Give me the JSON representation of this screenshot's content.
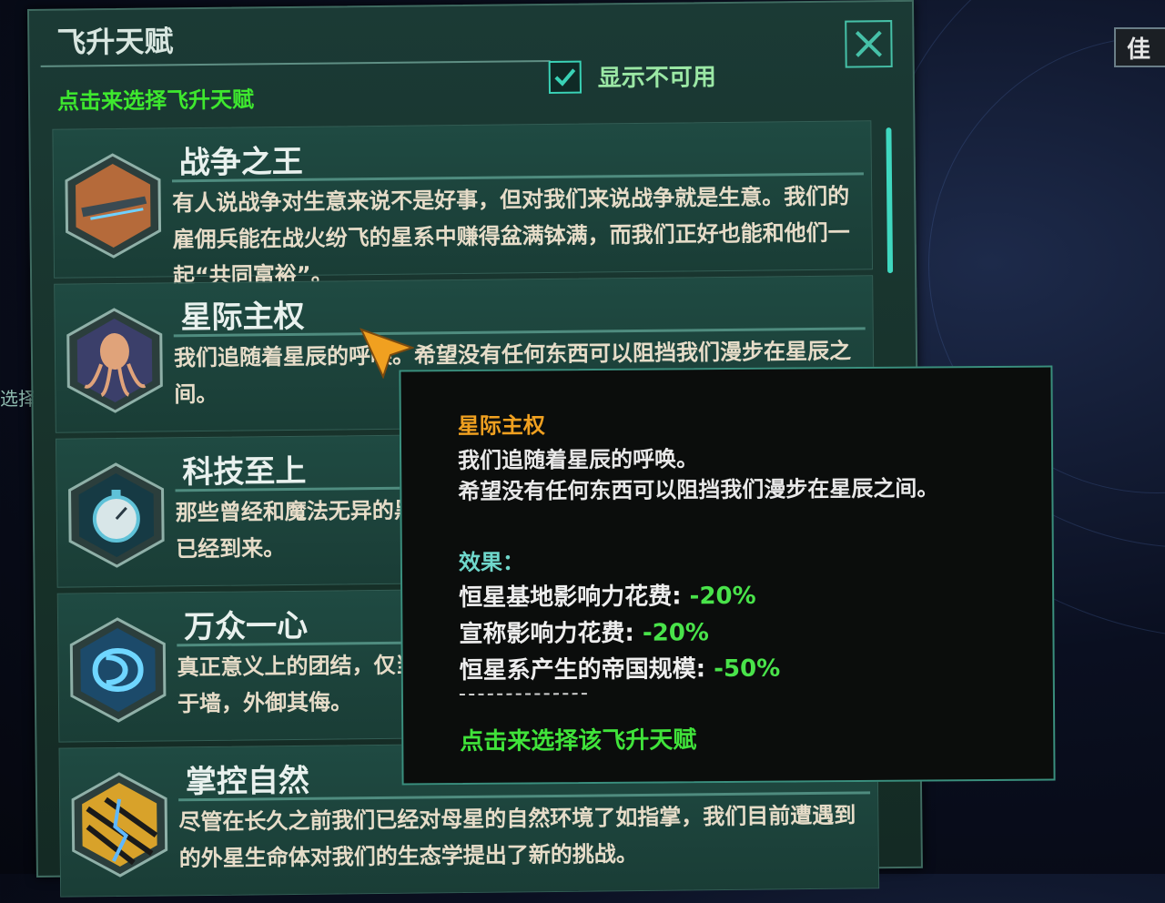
{
  "panel": {
    "title": "飞升天赋",
    "subtitle": "点击来选择飞升天赋",
    "show_unavailable_label": "显示不可用",
    "show_unavailable_checked": true
  },
  "background": {
    "top_right_badge": "佳",
    "left_edge_text": "选择"
  },
  "perks": [
    {
      "name": "战争之王",
      "icon": "warship-icon",
      "desc": "有人说战争对生意来说不是好事，但对我们来说战争就是生意。我们的雇佣兵能在战火纷飞的星系中赚得盆满钵满，而我们正好也能和他们一起“共同富裕”。"
    },
    {
      "name": "星际主权",
      "icon": "octopus-icon",
      "desc": "我们追随着星辰的呼唤。希望没有任何东西可以阻挡我们漫步在星辰之间。"
    },
    {
      "name": "科技至上",
      "icon": "stopwatch-icon",
      "desc": "那些曾经和魔法无异的黑科技现在已经触手可及。一个全新的科技纪元已经到来。"
    },
    {
      "name": "万众一心",
      "icon": "knot-icon",
      "desc": "真正意义上的团结，仅当国家面对外部威胁时，才能得以实现。兄弟阋于墙，外御其侮。"
    },
    {
      "name": "掌控自然",
      "icon": "nature-icon",
      "desc": "尽管在长久之前我们已经对母星的自然环境了如指掌，我们目前遭遇到的外星生命体对我们的生态学提出了新的挑战。"
    }
  ],
  "tooltip": {
    "title": "星际主权",
    "line1": "我们追随着星辰的呼唤。",
    "line2": "希望没有任何东西可以阻挡我们漫步在星辰之间。",
    "effects_label": "效果：",
    "effects": [
      {
        "label": "恒星基地影响力花费: ",
        "value": "-20%"
      },
      {
        "label": "宣称影响力花费: ",
        "value": "-20%"
      },
      {
        "label": "恒星系产生的帝国规模: ",
        "value": "-50%"
      }
    ],
    "action": "点击来选择该飞升天赋"
  },
  "colors": {
    "accent_green": "#3ee82e",
    "value_green": "#49e34a",
    "tooltip_title": "#f0a020",
    "panel_bg": "#1b3a35"
  }
}
